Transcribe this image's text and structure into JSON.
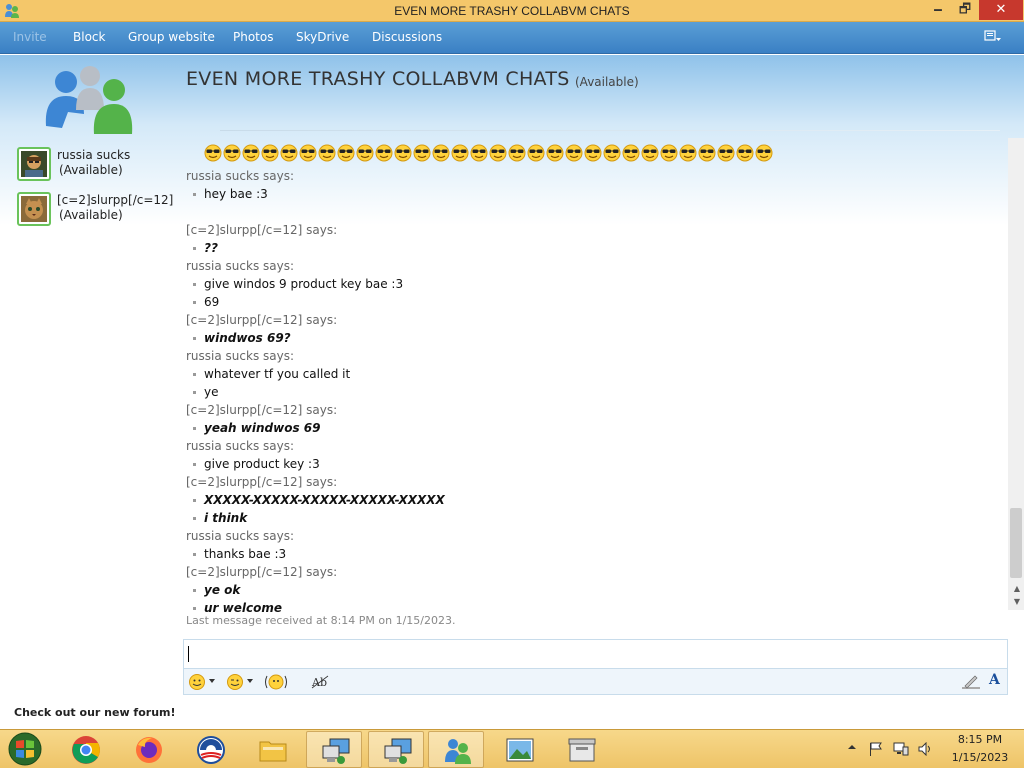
{
  "window": {
    "title": "EVEN MORE TRASHY COLLABVM CHATS",
    "min": "🗕",
    "max": "🗗",
    "close": "✕"
  },
  "toolbar": {
    "items": [
      {
        "label": "Invite",
        "disabled": true
      },
      {
        "label": "Block",
        "disabled": false
      },
      {
        "label": "Group website",
        "disabled": false
      },
      {
        "label": "Photos",
        "disabled": false
      },
      {
        "label": "SkyDrive",
        "disabled": false
      },
      {
        "label": "Discussions",
        "disabled": false
      }
    ]
  },
  "contacts": [
    {
      "name": "russia sucks",
      "status": "(Available)"
    },
    {
      "name": "[c=2]slurpp[/c=12]",
      "status": "(Available)"
    }
  ],
  "sidebar": {
    "forum_link": "Check out our new forum!"
  },
  "chat": {
    "title": "EVEN MORE TRASHY COLLABVM CHATS",
    "status": "(Available)",
    "smiley_count": 30,
    "messages": [
      {
        "type": "says",
        "text": "russia sucks says:"
      },
      {
        "type": "line",
        "text": "hey bae :3",
        "bold": false
      },
      {
        "type": "spacer"
      },
      {
        "type": "says",
        "text": "[c=2]slurpp[/c=12] says:"
      },
      {
        "type": "line",
        "text": "??",
        "bold": true
      },
      {
        "type": "says",
        "text": "russia sucks says:"
      },
      {
        "type": "line",
        "text": "give windos 9 product key bae :3",
        "bold": false
      },
      {
        "type": "line",
        "text": "69",
        "bold": false
      },
      {
        "type": "says",
        "text": "[c=2]slurpp[/c=12] says:"
      },
      {
        "type": "line",
        "text": "windwos 69?",
        "bold": true
      },
      {
        "type": "says",
        "text": "russia sucks says:"
      },
      {
        "type": "line",
        "text": "whatever tf you called it",
        "bold": false
      },
      {
        "type": "line",
        "text": "ye",
        "bold": false
      },
      {
        "type": "says",
        "text": "[c=2]slurpp[/c=12] says:"
      },
      {
        "type": "line",
        "text": "yeah windwos 69",
        "bold": true
      },
      {
        "type": "says",
        "text": "russia sucks says:"
      },
      {
        "type": "line",
        "text": "give product key :3",
        "bold": false
      },
      {
        "type": "says",
        "text": "[c=2]slurpp[/c=12] says:"
      },
      {
        "type": "line",
        "text": "XXXXX-XXXXX-XXXXX-XXXXX-XXXXX",
        "bold": true
      },
      {
        "type": "line",
        "text": "i think",
        "bold": true
      },
      {
        "type": "says",
        "text": "russia sucks says:"
      },
      {
        "type": "line",
        "text": "thanks bae :3",
        "bold": false
      },
      {
        "type": "says",
        "text": "[c=2]slurpp[/c=12] says:"
      },
      {
        "type": "line",
        "text": "ye ok",
        "bold": true
      },
      {
        "type": "line",
        "text": "ur welcome",
        "bold": true
      }
    ],
    "last_message": "Last message received at 8:14 PM on 1/15/2023."
  },
  "input": {
    "value": "",
    "font_button": "A"
  },
  "taskbar": {
    "apps": [
      "start-orb",
      "chrome",
      "firefox",
      "obama-logo",
      "file-explorer",
      "remote-desktop",
      "remote-desktop-2",
      "messenger",
      "photo-viewer",
      "archive"
    ],
    "clock_time": "8:15 PM",
    "clock_date": "1/15/2023"
  },
  "colors": {
    "titlebar": "#f4c76a",
    "toolbar": "#3a80c4",
    "taskbar": "#eec468",
    "available": "#6ac35b"
  }
}
